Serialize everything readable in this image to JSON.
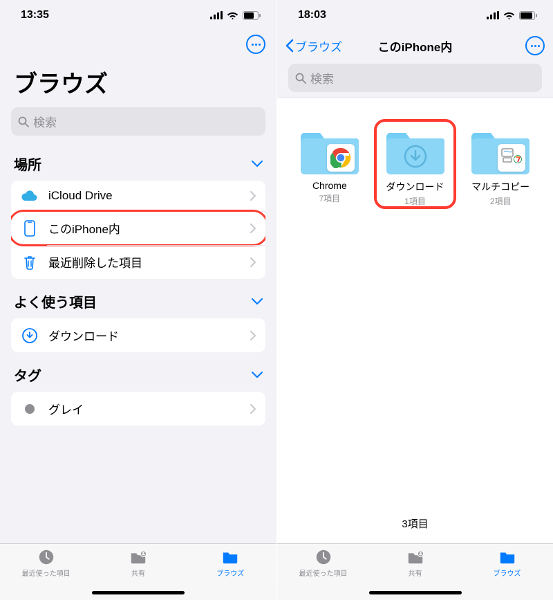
{
  "left": {
    "time": "13:35",
    "title": "ブラウズ",
    "search_placeholder": "検索",
    "sections": {
      "locations_label": "場所",
      "favorites_label": "よく使う項目",
      "tags_label": "タグ"
    },
    "locations": [
      {
        "label": "iCloud Drive"
      },
      {
        "label": "このiPhone内"
      },
      {
        "label": "最近削除した項目"
      }
    ],
    "favorites": [
      {
        "label": "ダウンロード"
      }
    ],
    "tags": [
      {
        "label": "グレイ"
      }
    ]
  },
  "right": {
    "time": "18:03",
    "back_label": "ブラウズ",
    "title": "このiPhone内",
    "search_placeholder": "検索",
    "folders": [
      {
        "name": "Chrome",
        "count": "7項目",
        "overlay": "chrome"
      },
      {
        "name": "ダウンロード",
        "count": "1項目",
        "overlay": "download",
        "highlighted": true
      },
      {
        "name": "マルチコピー",
        "count": "2項目",
        "overlay": "seven"
      }
    ],
    "footer_count": "3項目"
  },
  "tabs": [
    {
      "label": "最近使った項目",
      "active": false
    },
    {
      "label": "共有",
      "active": false
    },
    {
      "label": "ブラウズ",
      "active": true
    }
  ]
}
